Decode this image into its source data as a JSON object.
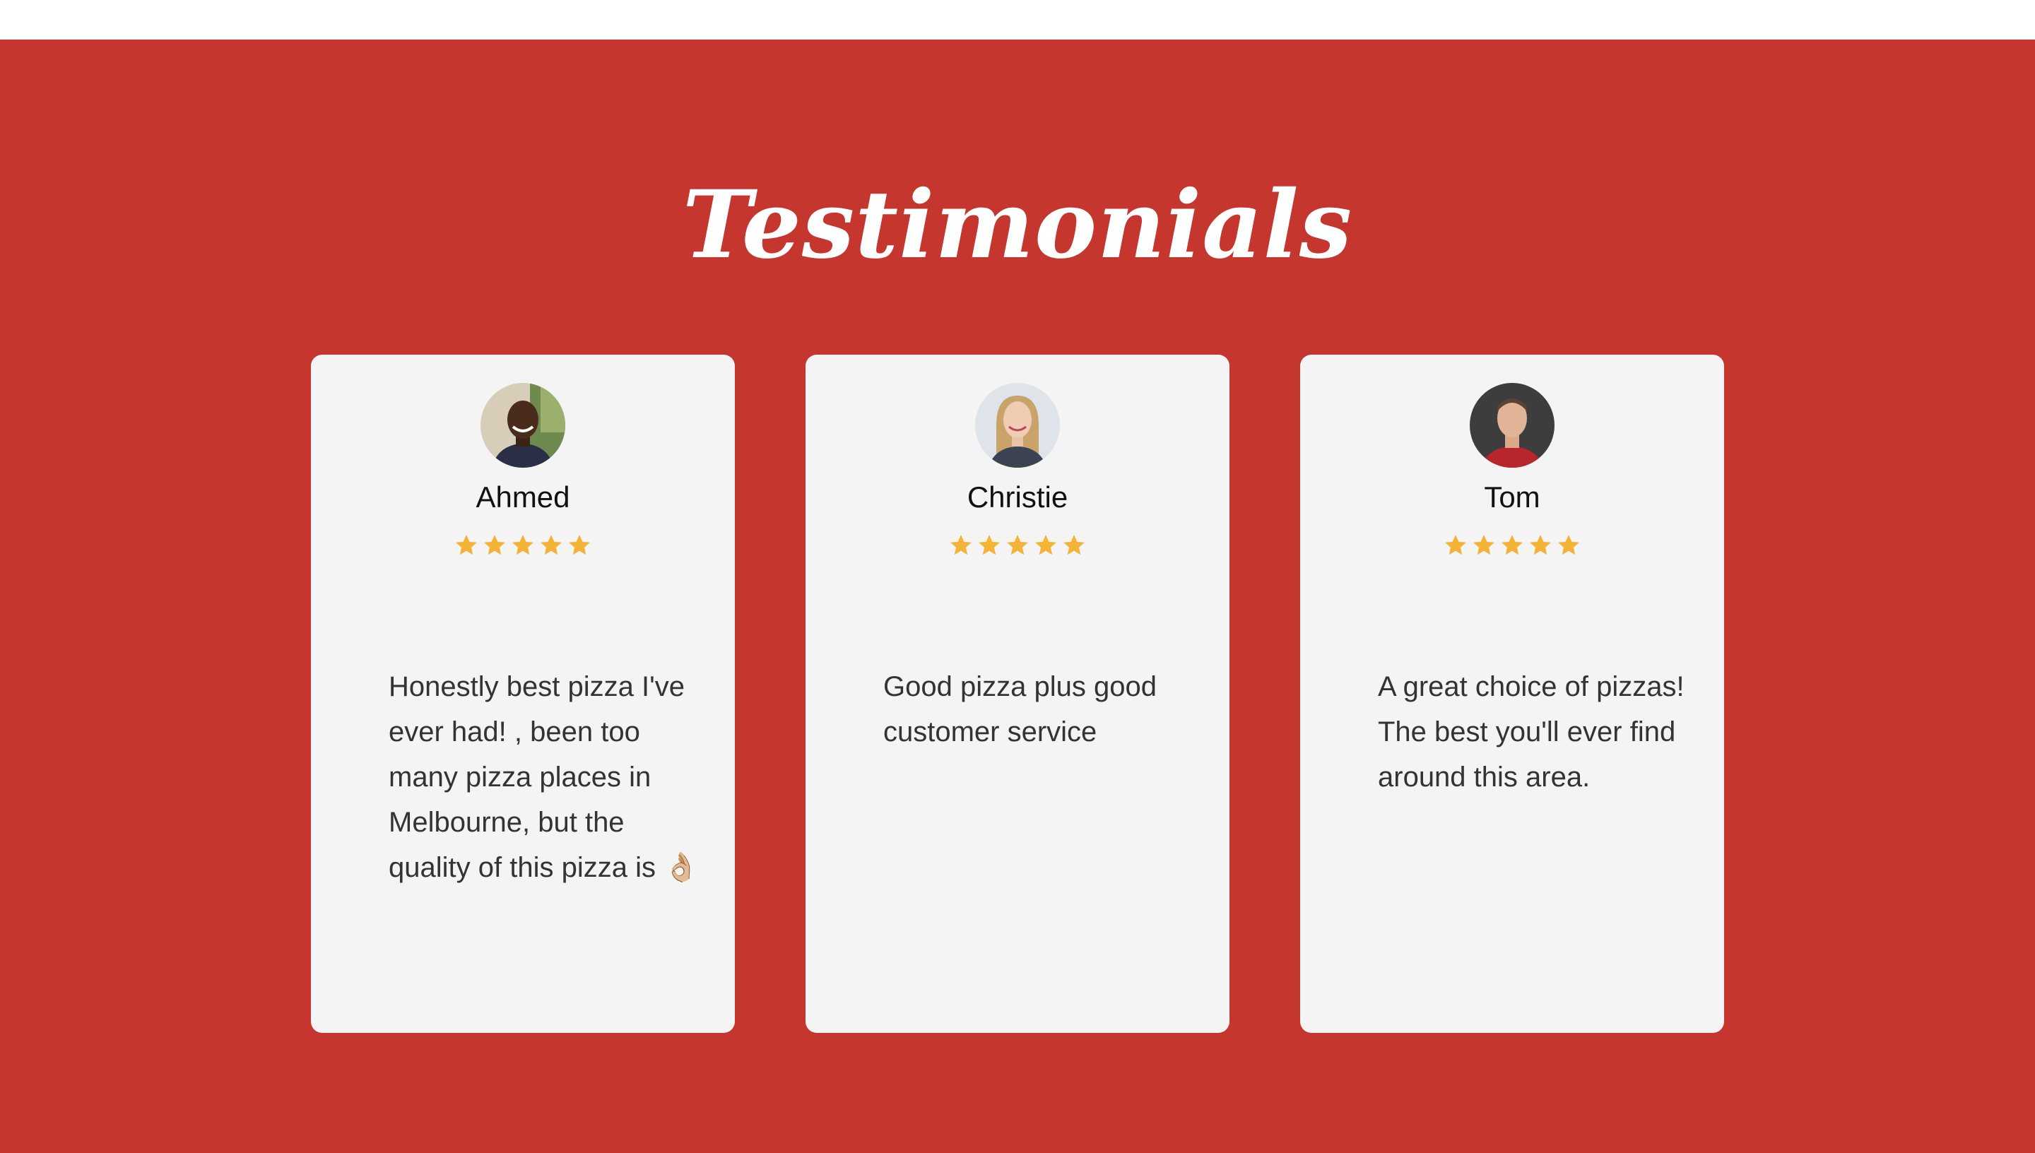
{
  "section": {
    "title": "Testimonials",
    "background_color": "#c5362f"
  },
  "testimonials": [
    {
      "name": "Ahmed",
      "rating": 5,
      "avatar_icon": "avatar-photo",
      "text": "Honestly best pizza I've ever had! , been too many pizza places in Melbourne, but the quality of this pizza is 👌🏼"
    },
    {
      "name": "Christie",
      "rating": 5,
      "avatar_icon": "avatar-photo",
      "text": "Good pizza plus good customer service"
    },
    {
      "name": "Tom",
      "rating": 5,
      "avatar_icon": "avatar-photo",
      "text": "A great choice of pizzas! The best you'll ever find around this area."
    }
  ],
  "colors": {
    "star": "#f5b335",
    "card_background": "#f4f4f4",
    "heading_text": "#ffffff"
  }
}
